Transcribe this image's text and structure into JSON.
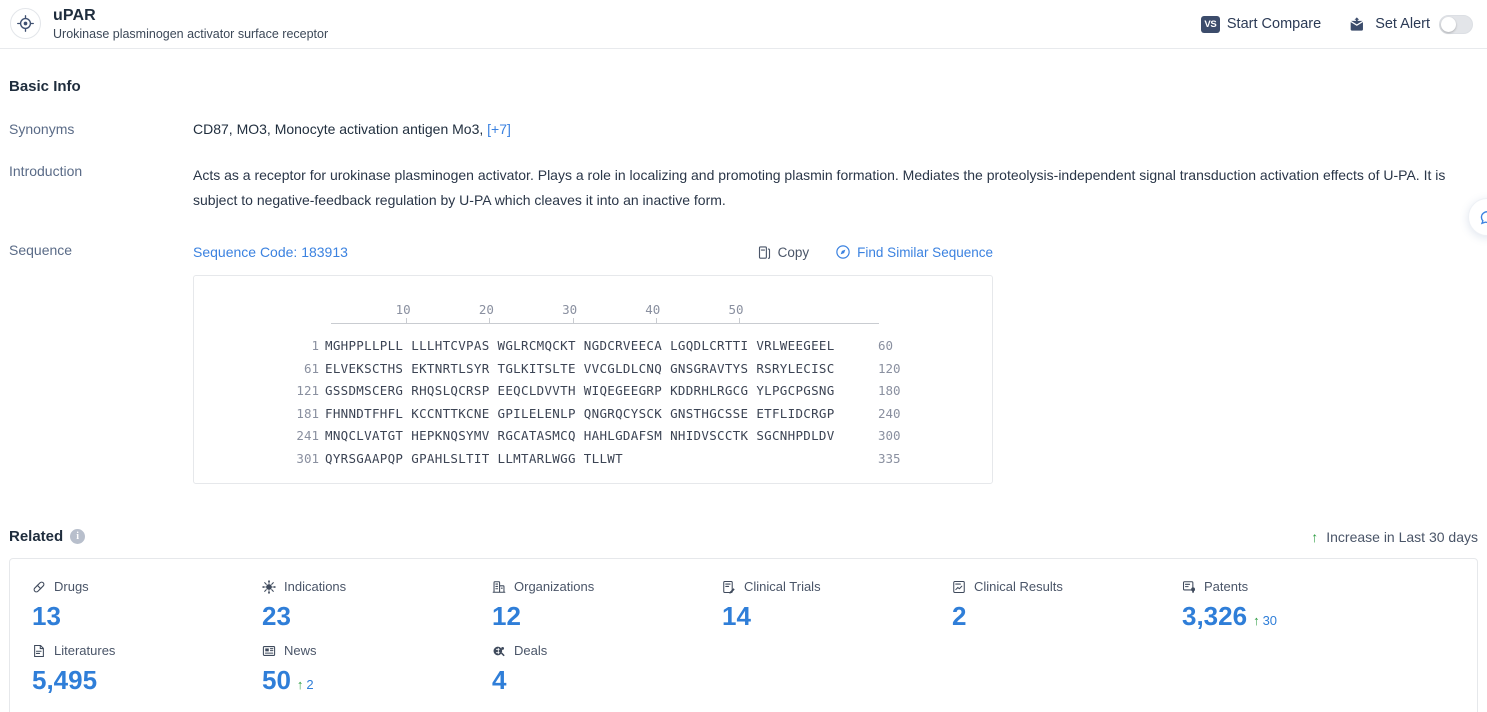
{
  "header": {
    "logo_icon": "target-icon",
    "title": "uPAR",
    "subtitle": "Urokinase plasminogen activator surface receptor",
    "compare_chip": "VS",
    "compare_label": "Start Compare",
    "alert_icon": "alert-mail-icon",
    "alert_label": "Set Alert",
    "alert_enabled": false
  },
  "basic_info": {
    "title": "Basic Info",
    "synonyms_label": "Synonyms",
    "synonyms_value": "CD87,  MO3,  Monocyte activation antigen Mo3,",
    "synonyms_more": "[+7]",
    "introduction_label": "Introduction",
    "introduction_value": "Acts as a receptor for urokinase plasminogen activator. Plays a role in localizing and promoting plasmin formation. Mediates the proteolysis-independent signal transduction activation effects of U-PA. It is subject to negative-feedback regulation by U-PA which cleaves it into an inactive form.",
    "sequence_label": "Sequence",
    "sequence_code": "Sequence Code: 183913",
    "copy_label": "Copy",
    "copy_icon": "copy-icon",
    "find_similar_label": "Find Similar Sequence",
    "find_similar_icon": "compass-icon"
  },
  "sequence": {
    "ruler": [
      10,
      20,
      30,
      40,
      50
    ],
    "lines": [
      {
        "start": "1",
        "chunks": [
          "MGHPPLLPLL",
          "LLLHTCVPAS",
          "WGLRCMQCKT",
          "NGDCRVEECA",
          "LGQDLCRTTI",
          "VRLWEEGEEL"
        ],
        "end": "60"
      },
      {
        "start": "61",
        "chunks": [
          "ELVEKSCTHS",
          "EKTNRTLSYR",
          "TGLKITSLTE",
          "VVCGLDLCNQ",
          "GNSGRAVTYS",
          "RSRYLECISC"
        ],
        "end": "120"
      },
      {
        "start": "121",
        "chunks": [
          "GSSDMSCERG",
          "RHQSLQCRSP",
          "EEQCLDVVTH",
          "WIQEGEEGRP",
          "KDDRHLRGCG",
          "YLPGCPGSNG"
        ],
        "end": "180"
      },
      {
        "start": "181",
        "chunks": [
          "FHNNDTFHFL",
          "KCCNTTKCNE",
          "GPILELENLP",
          "QNGRQCYSCK",
          "GNSTHGCSSE",
          "ETFLIDCRGP"
        ],
        "end": "240"
      },
      {
        "start": "241",
        "chunks": [
          "MNQCLVATGT",
          "HEPKNQSYMV",
          "RGCATASMCQ",
          "HAHLGDAFSM",
          "NHIDVSCCTK",
          "SGCNHPDLDV"
        ],
        "end": "300"
      },
      {
        "start": "301",
        "chunks": [
          "QYRSGAAPQP",
          "GPAHLSLTIT",
          "LLMTARLWGG",
          "TLLWT"
        ],
        "end": "335"
      }
    ]
  },
  "related": {
    "title": "Related",
    "info_icon": "info-icon",
    "increase_note": "Increase in Last 30 days",
    "increase_arrow": "arrow-up-icon",
    "accent_color": "#2f7ed8",
    "increase_color": "#2f9e44",
    "stats": [
      {
        "label": "Drugs",
        "icon": "pill-icon",
        "value": "13",
        "delta": ""
      },
      {
        "label": "Indications",
        "icon": "virus-icon",
        "value": "23",
        "delta": ""
      },
      {
        "label": "Organizations",
        "icon": "building-icon",
        "value": "12",
        "delta": ""
      },
      {
        "label": "Clinical Trials",
        "icon": "clinical-trial-icon",
        "value": "14",
        "delta": ""
      },
      {
        "label": "Clinical Results",
        "icon": "clinical-result-icon",
        "value": "2",
        "delta": ""
      },
      {
        "label": "Patents",
        "icon": "patent-icon",
        "value": "3,326",
        "delta": "30"
      },
      {
        "label": "Literatures",
        "icon": "literature-icon",
        "value": "5,495",
        "delta": ""
      },
      {
        "label": "News",
        "icon": "news-icon",
        "value": "50",
        "delta": "2"
      },
      {
        "label": "Deals",
        "icon": "deals-icon",
        "value": "4",
        "delta": ""
      }
    ]
  },
  "floating": {
    "icon": "chat-icon"
  }
}
